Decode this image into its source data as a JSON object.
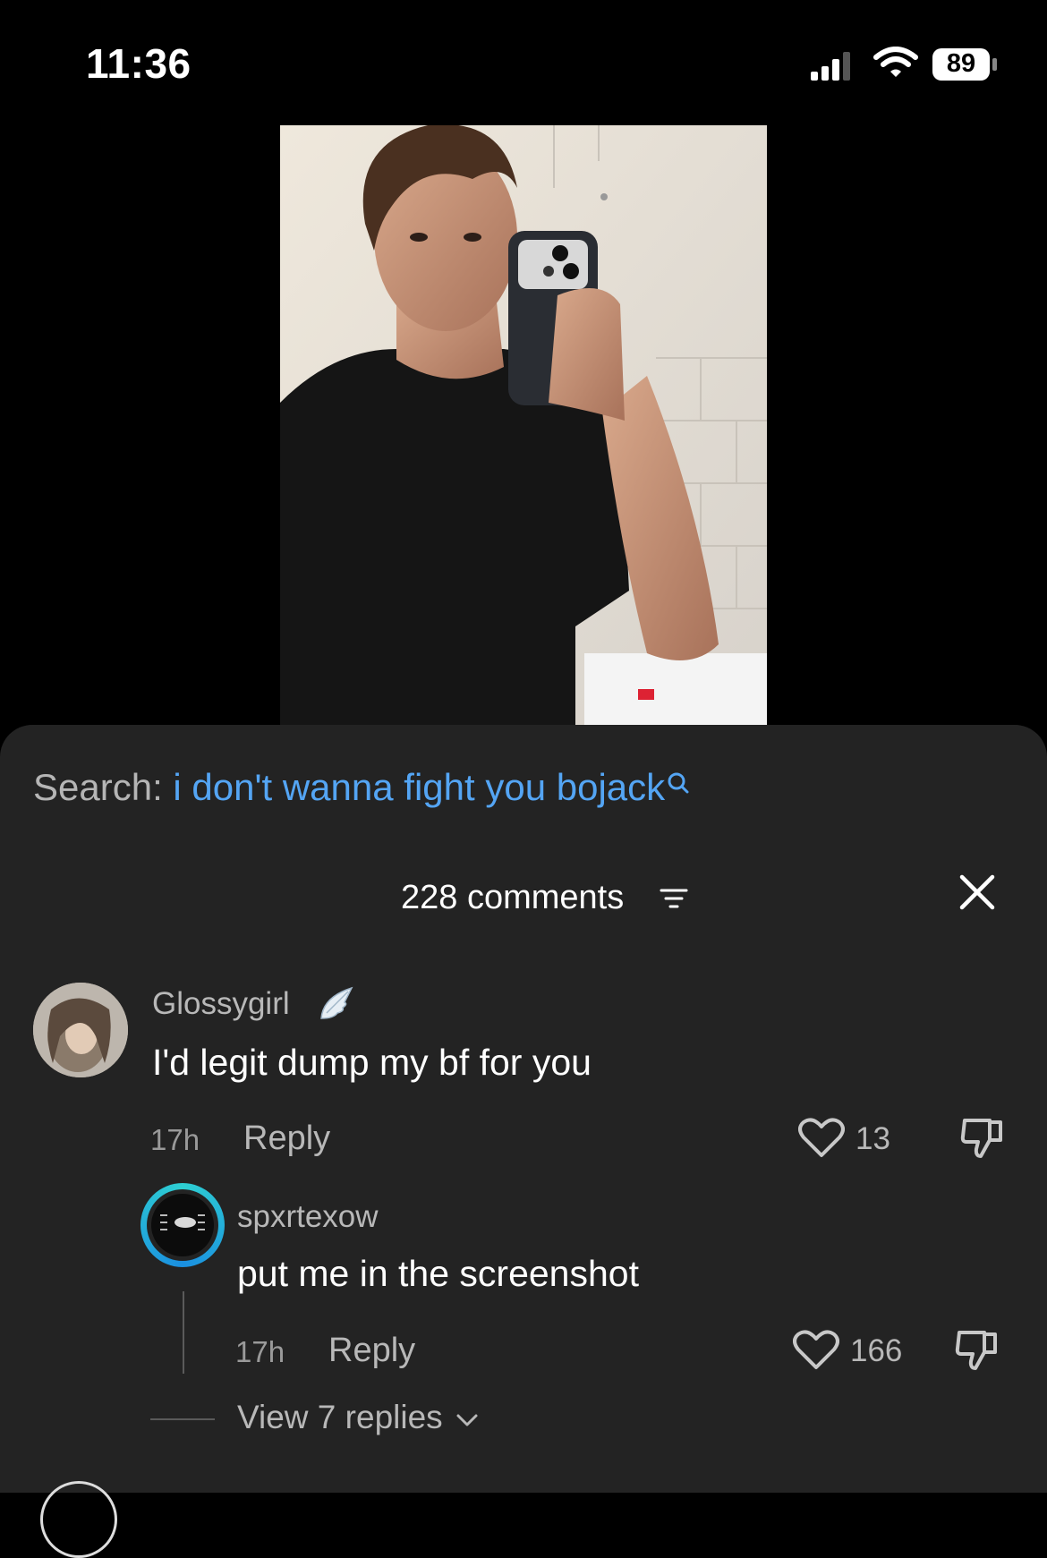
{
  "status": {
    "time": "11:36",
    "battery": "89"
  },
  "search": {
    "label": "Search:",
    "query": "i don't wanna fight you bojack"
  },
  "header": {
    "comment_count": "228 comments"
  },
  "comments": [
    {
      "username": "Glossygirl",
      "text": "I'd legit dump my bf for you",
      "time": "17h",
      "reply_label": "Reply",
      "likes": "13"
    },
    {
      "username": "spxrtexow",
      "text": "put me in the screenshot",
      "time": "17h",
      "reply_label": "Reply",
      "likes": "166"
    }
  ],
  "view_replies": "View 7 replies",
  "colors": {
    "sheet_bg": "#232323",
    "search_query": "#54a5f4",
    "muted": "#b8b8b8"
  }
}
